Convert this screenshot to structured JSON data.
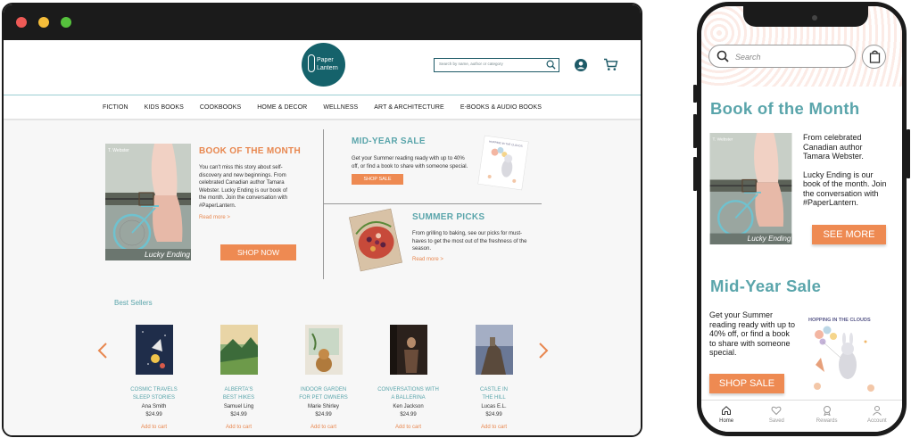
{
  "desktop": {
    "logo": {
      "line1": "Paper",
      "line2": "Lantern"
    },
    "search": {
      "placeholder": "Search by name, author or category"
    },
    "nav": [
      "FICTION",
      "KIDS BOOKS",
      "COOKBOOKS",
      "HOME & DECOR",
      "WELLNESS",
      "ART & ARCHITECTURE",
      "E-BOOKS & AUDIO BOOKS"
    ],
    "book_of_month": {
      "title": "BOOK OF THE MONTH",
      "text": "You can't miss this story about self-discovery and new beginnings. From celebrated Canadian author Tamara Webster. Lucky Ending is our book of the month. Join the conversation with #PaperLantern.",
      "read_more": "Read more >",
      "cta": "SHOP NOW",
      "cover_author": "T. Webster",
      "cover_title": "Lucky Ending"
    },
    "mid_year_sale": {
      "title": "MID-YEAR SALE",
      "text": "Get your Summer reading ready with up to 40% off, or find a book to share with someone special.",
      "cta": "SHOP SALE",
      "cover_title": "HOPPING IN THE CLOUDS"
    },
    "summer_picks": {
      "title": "SUMMER PICKS",
      "text": "From grilling to baking, see our picks for must-haves to get the most out of the freshness of the season.",
      "read_more": "Read more >"
    },
    "best_sellers": {
      "title": "Best Sellers",
      "books": [
        {
          "title_line1": "COSMIC TRAVELS",
          "title_line2": "SLEEP STORIES",
          "author": "Ana Smith",
          "price": "$24.99",
          "add": "Add to cart"
        },
        {
          "title_line1": "ALBERTA'S",
          "title_line2": "BEST HIKES",
          "author": "Samuel Ling",
          "price": "$24.99",
          "add": "Add to cart"
        },
        {
          "title_line1": "INDOOR GARDEN",
          "title_line2": "FOR PET OWNERS",
          "author": "Marie Shirley",
          "price": "$24.99",
          "add": "Add to cart"
        },
        {
          "title_line1": "CONVERSATIONS WITH",
          "title_line2": "A BALLERINA",
          "author": "Ken Jackson",
          "price": "$24.99",
          "add": "Add to cart"
        },
        {
          "title_line1": "CASTLE IN",
          "title_line2": "THE HILL",
          "author": "Lucas E.L.",
          "price": "$24.99",
          "add": "Add to cart"
        }
      ]
    }
  },
  "mobile": {
    "search": {
      "placeholder": "Search"
    },
    "book_of_month": {
      "title": "Book of the Month",
      "text1": "From celebrated Canadian author Tamara Webster.",
      "text2": "Lucky Ending is our book of the month. Join the conversation with #PaperLantern.",
      "cta": "SEE MORE"
    },
    "mid_year_sale": {
      "title": "Mid-Year Sale",
      "text": "Get your Summer reading ready with up to 40% off, or find a book to share with someone special.",
      "cta": "SHOP SALE"
    },
    "tabs": [
      {
        "label": "Home",
        "icon": "home-icon"
      },
      {
        "label": "Saved",
        "icon": "heart-icon"
      },
      {
        "label": "Rewards",
        "icon": "rewards-icon"
      },
      {
        "label": "Account",
        "icon": "account-icon"
      }
    ]
  },
  "colors": {
    "teal": "#5aa5ab",
    "logo": "#15626b",
    "orange": "#ee8a52"
  }
}
